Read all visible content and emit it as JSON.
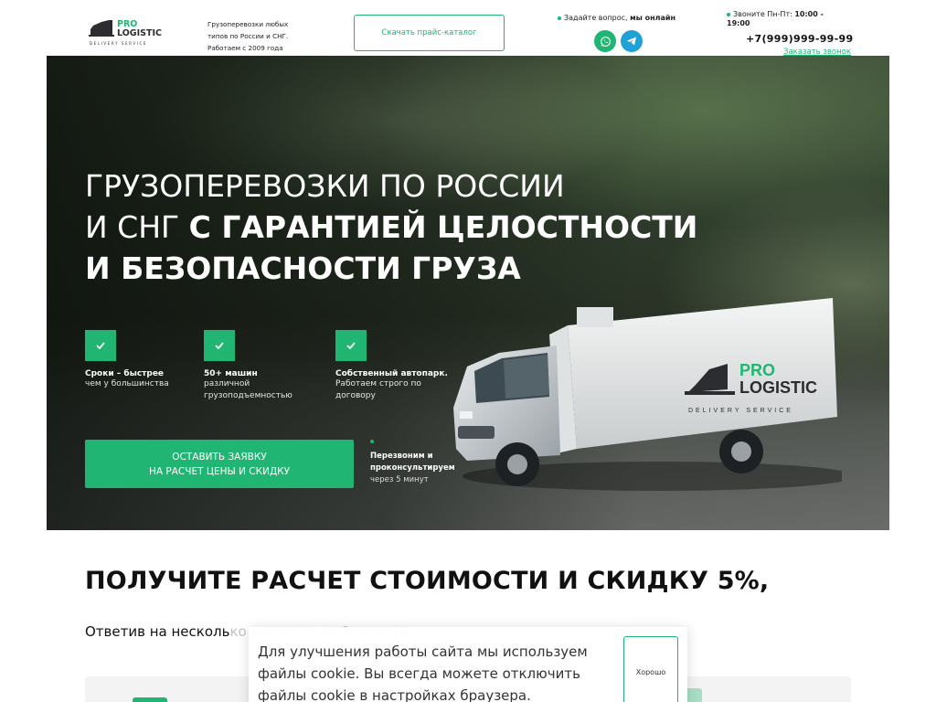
{
  "header": {
    "logo": {
      "line1": "PRO",
      "line2": "LOGISTIC",
      "line3": "DELIVERY SERVICE"
    },
    "tagline": "Грузоперевозки любых типов по России и СНГ. Работаем с 2009 года",
    "catalog_button": "Скачать прайс-каталог",
    "ask": {
      "text": "Задайте вопрос, ",
      "online": "мы онлайн"
    },
    "messengers": {
      "whatsapp": "whatsapp-icon",
      "telegram": "telegram-icon"
    },
    "hours": {
      "label": "Звоните Пн-Пт: ",
      "time": "10:00 - 19:00"
    },
    "phone": "+7(999)999-99-99",
    "callback_link": "Заказать звонок"
  },
  "hero": {
    "title_line1": "ГРУЗОПЕРЕВОЗКИ ПО РОССИИ",
    "title_line2_plain": "И СНГ ",
    "title_line2_bold": "С ГАРАНТИЕЙ ЦЕЛОСТНОСТИ",
    "title_line3_bold": "И БЕЗОПАСНОСТИ ГРУЗА",
    "features": [
      {
        "title": "Сроки – быстрее",
        "desc": "чем у большинства"
      },
      {
        "title": "50+ машин",
        "desc": "различной грузоподъемностью"
      },
      {
        "title": "Собственный автопарк.",
        "desc": "Работаем строго по договору"
      }
    ],
    "cta_line1": "ОСТАВИТЬ ЗАЯВКУ",
    "cta_line2": "НА РАСЧЕТ ЦЕНЫ И СКИДКУ",
    "callnote_bold": "Перезвоним и проконсультируем",
    "callnote_rest": "через 5 минут",
    "truck_logo": {
      "line1": "PRO",
      "line2": "LOGISTIC",
      "line3": "DELIVERY SERVICE"
    }
  },
  "section": {
    "title": "ПОЛУЧИТЕ РАСЧЕТ СТОИМОСТИ И СКИДКУ 5%,",
    "subtitle_visible": "Ответив на несколь",
    "subtitle_faded": "ко вопросов за 2 минуты"
  },
  "cookie": {
    "text": "Для улучшения работы сайта мы используем файлы cookie. Вы всегда можете отключить файлы cookie в настройках браузера.",
    "button": "Хорошо"
  },
  "colors": {
    "accent": "#21b573",
    "telegram": "#1fa0d6",
    "text": "#111111"
  }
}
